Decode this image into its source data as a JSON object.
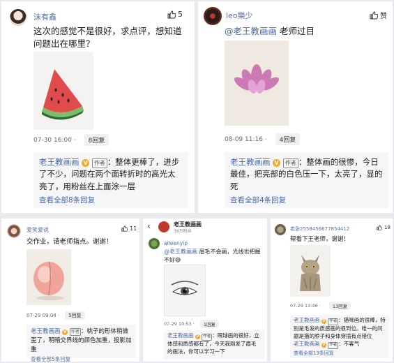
{
  "p1": {
    "user": "沫有鑫",
    "likes": "5",
    "text": "这次的感觉不是很好，求点评，想知道问题出在哪里？",
    "time": "07-30 16:00 ·",
    "reply_count": "8回复",
    "reply_author": "老王教画画",
    "reply_tag": "作者",
    "reply_text": "：整体更棒了，进步了不少，问题在两个面转折时的高光太亮了，用粉丝在上面涂一层",
    "view_all": "查看全部8条回复"
  },
  "p2": {
    "user": "leo樂少",
    "likes": "赞",
    "mention": "@老王教画画",
    "text": " 老师过目",
    "time": "08-09 11:16 ·",
    "reply_count": "4回复",
    "reply_author": "老王教画画",
    "reply_tag": "作者",
    "reply_text": "：整体画的很惨，今日最佳，把亮部的白色压一下，太亮了，显的死",
    "view_all": "查看全部4条回复"
  },
  "p3": {
    "user": "爱笑爱说",
    "likes": "11",
    "text": "交作业，请老师指点。谢谢！",
    "time": "07-29 09:04 ·",
    "reply_count": "5回复",
    "reply_author": "老王教画画",
    "reply_tag": "作者",
    "reply_text": "：桃子的形体稍微歪了，明暗交界线的颜色加重，投影加重",
    "view_all": "查看全部5条回复"
  },
  "p4": {
    "header_title": "老王教画画",
    "header_sub": "38万粉丝",
    "user": "aileenyip",
    "mention": "@老王教画画",
    "text": " 眉毛不会画，光线也把握不好😅",
    "time": "07-29 10:53 ·",
    "reply_count": "1回复",
    "reply_author": "老王教画画",
    "reply_tag": "作者",
    "reply_text": "：眼球画的很好，立体感和质感都有了，今天我刚发了眉毛的画法，你可以学习一下"
  },
  "p5": {
    "user": "老张2558456677854412",
    "likes": "18",
    "text": "帮看下王老师，谢谢！",
    "time": "07-29 13:46 ·",
    "reply_count": "13回复",
    "reply_author": "老王教画画",
    "reply_tag": "作者",
    "reply_text": "：猫咪画的很棒，特别是毛发的质感画的很到位。唯一的问题是猫的脖子和身体穿插有点错位",
    "reply2_author": "老王教画画",
    "reply2_tag": "作者",
    "reply2_text": "：不客气",
    "view_all": "查看全部13条回复"
  },
  "badge": "V",
  "colors": {
    "link": "#4a6aa8",
    "badge": "#f5a623",
    "reply_bg": "#f6f6f8"
  }
}
